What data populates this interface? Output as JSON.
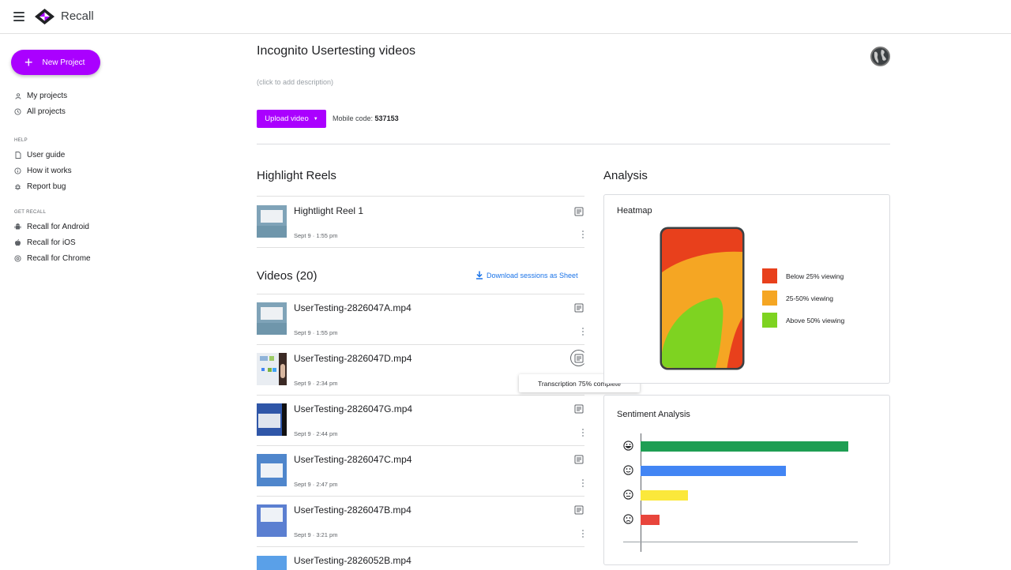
{
  "app": {
    "name": "Recall"
  },
  "sidebar": {
    "new_project_label": "New Project",
    "primary": [
      {
        "label": "My projects",
        "icon": "person-icon"
      },
      {
        "label": "All projects",
        "icon": "clock-icon"
      }
    ],
    "help_label": "HELP",
    "help": [
      {
        "label": "User guide",
        "icon": "document-icon"
      },
      {
        "label": "How it works",
        "icon": "info-icon"
      },
      {
        "label": "Report bug",
        "icon": "bug-icon"
      }
    ],
    "get_label": "GET RECALL",
    "get": [
      {
        "label": "Recall for Android",
        "icon": "android-icon"
      },
      {
        "label": "Recall for iOS",
        "icon": "apple-icon"
      },
      {
        "label": "Recall for Chrome",
        "icon": "chrome-icon"
      }
    ]
  },
  "project": {
    "title": "Incognito Usertesting videos",
    "description_placeholder": "(click to add description)",
    "upload_label": "Upload video",
    "mobile_code_label": "Mobile code:",
    "mobile_code": "537153"
  },
  "highlights": {
    "title": "Highlight Reels",
    "items": [
      {
        "title": "Hightlight Reel 1",
        "date": "Sept 9 · 1:55 pm"
      }
    ]
  },
  "videos": {
    "title": "Videos (20)",
    "download_label": "Download sessions as Sheet",
    "items": [
      {
        "title": "UserTesting-2826047A.mp4",
        "date": "Sept 9 · 1:55 pm"
      },
      {
        "title": "UserTesting-2826047D.mp4",
        "date": "Sept 9 · 2:34 pm"
      },
      {
        "title": "UserTesting-2826047G.mp4",
        "date": "Sept 9 · 2:44 pm"
      },
      {
        "title": "UserTesting-2826047C.mp4",
        "date": "Sept 9 · 2:47 pm"
      },
      {
        "title": "UserTesting-2826047B.mp4",
        "date": "Sept 9 · 3:21 pm"
      },
      {
        "title": "UserTesting-2826052B.mp4",
        "date": ""
      }
    ],
    "tooltip": "Transcription 75% complete",
    "transcription_progress": 0.75
  },
  "analysis": {
    "title": "Analysis",
    "heatmap": {
      "title": "Heatmap",
      "legend": [
        {
          "label": "Below 25% viewing",
          "color": "#e8401c"
        },
        {
          "label": "25-50% viewing",
          "color": "#f5a623"
        },
        {
          "label": "Above 50% viewing",
          "color": "#7ed321"
        }
      ]
    },
    "sentiment": {
      "title": "Sentiment Analysis",
      "bars": [
        {
          "face": "very-happy-face-icon",
          "value": 1.0,
          "color": "#1e9e53"
        },
        {
          "face": "happy-face-icon",
          "value": 0.7,
          "color": "#4285f4"
        },
        {
          "face": "neutral-face-icon",
          "value": 0.23,
          "color": "#fbe83b"
        },
        {
          "face": "sad-face-icon",
          "value": 0.09,
          "color": "#e8453c"
        }
      ]
    }
  },
  "colors": {
    "accent": "#aa00ff",
    "link": "#1a73e8"
  }
}
